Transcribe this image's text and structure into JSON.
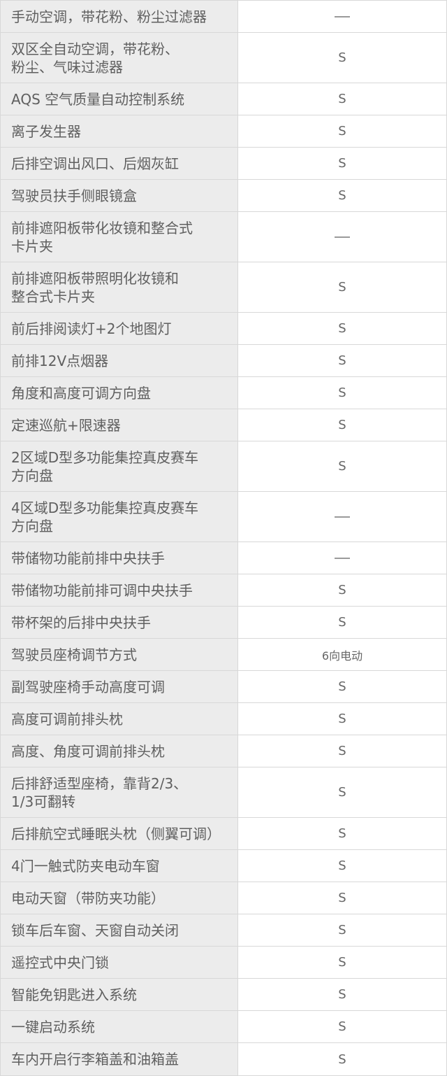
{
  "rows": [
    {
      "feature": "手动空调，带花粉、粉尘过滤器",
      "value": "—",
      "h": 46
    },
    {
      "feature": "双区全自动空调，带花粉、\n粉尘、气味过滤器",
      "value": "S",
      "h": 72
    },
    {
      "feature": "AQS 空气质量自动控制系统",
      "value": "S",
      "h": 46
    },
    {
      "feature": "离子发生器",
      "value": "S",
      "h": 46
    },
    {
      "feature": "后排空调出风口、后烟灰缸",
      "value": "S",
      "h": 46
    },
    {
      "feature": "驾驶员扶手侧眼镜盒",
      "value": "S",
      "h": 46
    },
    {
      "feature": "前排遮阳板带化妆镜和整合式\n卡片夹",
      "value": "—",
      "h": 72
    },
    {
      "feature": "前排遮阳板带照明化妆镜和\n整合式卡片夹",
      "value": "S",
      "h": 72
    },
    {
      "feature": "前后排阅读灯+2个地图灯",
      "value": "S",
      "h": 46
    },
    {
      "feature": "前排12V点烟器",
      "value": "S",
      "h": 46
    },
    {
      "feature": "角度和高度可调方向盘",
      "value": "S",
      "h": 46
    },
    {
      "feature": "定速巡航+限速器",
      "value": "S",
      "h": 46
    },
    {
      "feature": "2区域D型多功能集控真皮赛车\n方向盘",
      "value": "S",
      "h": 72
    },
    {
      "feature": "4区域D型多功能集控真皮赛车\n方向盘",
      "value": "—",
      "h": 72
    },
    {
      "feature": "带储物功能前排中央扶手",
      "value": "—",
      "h": 46
    },
    {
      "feature": "带储物功能前排可调中央扶手",
      "value": "S",
      "h": 46
    },
    {
      "feature": "带杯架的后排中央扶手",
      "value": "S",
      "h": 46
    },
    {
      "feature": "驾驶员座椅调节方式",
      "value": "6向电动",
      "h": 46
    },
    {
      "feature": "副驾驶座椅手动高度可调",
      "value": "S",
      "h": 46
    },
    {
      "feature": "高度可调前排头枕",
      "value": "S",
      "h": 46
    },
    {
      "feature": "高度、角度可调前排头枕",
      "value": "S",
      "h": 46
    },
    {
      "feature": "后排舒适型座椅，靠背2/3、\n1/3可翻转",
      "value": "S",
      "h": 72
    },
    {
      "feature": "后排航空式睡眠头枕（侧翼可调）",
      "value": "S",
      "h": 46
    },
    {
      "feature": "4门一触式防夹电动车窗",
      "value": "S",
      "h": 46
    },
    {
      "feature": "电动天窗（带防夹功能）",
      "value": "S",
      "h": 46
    },
    {
      "feature": "锁车后车窗、天窗自动关闭",
      "value": "S",
      "h": 46
    },
    {
      "feature": "遥控式中央门锁",
      "value": "S",
      "h": 46
    },
    {
      "feature": "智能免钥匙进入系统",
      "value": "S",
      "h": 46
    },
    {
      "feature": "一键启动系统",
      "value": "S",
      "h": 46
    },
    {
      "feature": "车内开启行李箱盖和油箱盖",
      "value": "S",
      "h": 47
    }
  ]
}
